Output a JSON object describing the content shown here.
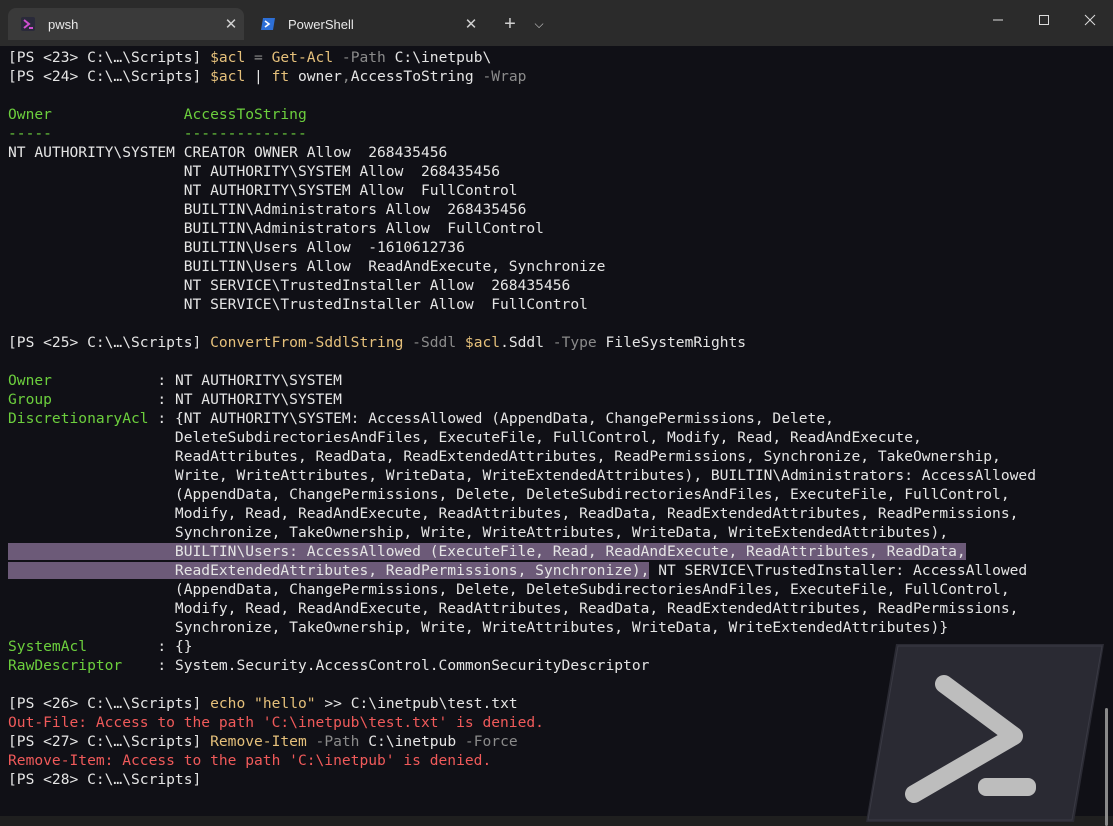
{
  "tabs": [
    {
      "label": "pwsh",
      "icon": "pwsh-icon",
      "active": true
    },
    {
      "label": "PowerShell",
      "icon": "powershell-icon",
      "active": false
    }
  ],
  "colors": {
    "background": "#101016",
    "prompt": "#e5e5e5",
    "keyword": "#e5c07b",
    "label": "#6ccf3d",
    "error": "#f05a5a",
    "selection": "#6a5a78"
  },
  "terminal": {
    "lines": [
      [
        {
          "t": "[PS <23> C:\\…\\Scripts] ",
          "c": "prompt"
        },
        {
          "t": "$acl",
          "c": "var"
        },
        {
          "t": " = ",
          "c": "param"
        },
        {
          "t": "Get-Acl",
          "c": "kw"
        },
        {
          "t": " -Path ",
          "c": "param"
        },
        {
          "t": "C:\\inetpub\\",
          "c": "prompt"
        }
      ],
      [
        {
          "t": "[PS <24> C:\\…\\Scripts] ",
          "c": "prompt"
        },
        {
          "t": "$acl",
          "c": "var"
        },
        {
          "t": " | ",
          "c": "prompt"
        },
        {
          "t": "ft",
          "c": "kw"
        },
        {
          "t": " owner",
          "c": "prompt"
        },
        {
          "t": ",",
          "c": "param"
        },
        {
          "t": "AccessToString",
          "c": "prompt"
        },
        {
          "t": " -Wrap",
          "c": "param"
        }
      ],
      [],
      [
        {
          "t": "Owner               ",
          "c": "lbl"
        },
        {
          "t": "AccessToString",
          "c": "lbl"
        }
      ],
      [
        {
          "t": "-----               ",
          "c": "lbl"
        },
        {
          "t": "--------------",
          "c": "lbl"
        }
      ],
      [
        {
          "t": "NT AUTHORITY\\SYSTEM CREATOR OWNER Allow  268435456",
          "c": "prompt"
        }
      ],
      [
        {
          "t": "                    NT AUTHORITY\\SYSTEM Allow  268435456",
          "c": "prompt"
        }
      ],
      [
        {
          "t": "                    NT AUTHORITY\\SYSTEM Allow  FullControl",
          "c": "prompt"
        }
      ],
      [
        {
          "t": "                    BUILTIN\\Administrators Allow  268435456",
          "c": "prompt"
        }
      ],
      [
        {
          "t": "                    BUILTIN\\Administrators Allow  FullControl",
          "c": "prompt"
        }
      ],
      [
        {
          "t": "                    BUILTIN\\Users Allow  -1610612736",
          "c": "prompt"
        }
      ],
      [
        {
          "t": "                    BUILTIN\\Users Allow  ReadAndExecute, Synchronize",
          "c": "prompt"
        }
      ],
      [
        {
          "t": "                    NT SERVICE\\TrustedInstaller Allow  268435456",
          "c": "prompt"
        }
      ],
      [
        {
          "t": "                    NT SERVICE\\TrustedInstaller Allow  FullControl",
          "c": "prompt"
        }
      ],
      [],
      [
        {
          "t": "[PS <25> C:\\…\\Scripts] ",
          "c": "prompt"
        },
        {
          "t": "ConvertFrom-SddlString",
          "c": "kw"
        },
        {
          "t": " -Sddl ",
          "c": "param"
        },
        {
          "t": "$acl",
          "c": "var"
        },
        {
          "t": ".Sddl",
          "c": "prompt"
        },
        {
          "t": " -Type ",
          "c": "param"
        },
        {
          "t": "FileSystemRights",
          "c": "prompt"
        }
      ],
      [],
      [
        {
          "t": "Owner            ",
          "c": "lbl"
        },
        {
          "t": ": NT AUTHORITY\\SYSTEM",
          "c": "prompt"
        }
      ],
      [
        {
          "t": "Group            ",
          "c": "lbl"
        },
        {
          "t": ": NT AUTHORITY\\SYSTEM",
          "c": "prompt"
        }
      ],
      [
        {
          "t": "DiscretionaryAcl ",
          "c": "lbl"
        },
        {
          "t": ": {NT AUTHORITY\\SYSTEM: AccessAllowed (AppendData, ChangePermissions, Delete,",
          "c": "prompt"
        }
      ],
      [
        {
          "t": "                   DeleteSubdirectoriesAndFiles, ExecuteFile, FullControl, Modify, Read, ReadAndExecute,",
          "c": "prompt"
        }
      ],
      [
        {
          "t": "                   ReadAttributes, ReadData, ReadExtendedAttributes, ReadPermissions, Synchronize, TakeOwnership,",
          "c": "prompt"
        }
      ],
      [
        {
          "t": "                   Write, WriteAttributes, WriteData, WriteExtendedAttributes), BUILTIN\\Administrators: AccessAllowed",
          "c": "prompt"
        }
      ],
      [
        {
          "t": "                   (AppendData, ChangePermissions, Delete, DeleteSubdirectoriesAndFiles, ExecuteFile, FullControl,",
          "c": "prompt"
        }
      ],
      [
        {
          "t": "                   Modify, Read, ReadAndExecute, ReadAttributes, ReadData, ReadExtendedAttributes, ReadPermissions,",
          "c": "prompt"
        }
      ],
      [
        {
          "t": "                   Synchronize, TakeOwnership, Write, WriteAttributes, WriteData, WriteExtendedAttributes),",
          "c": "prompt"
        }
      ],
      [
        {
          "t": "                   BUILTIN\\Users: AccessAllowed (ExecuteFile, Read, ReadAndExecute, ReadAttributes, ReadData,",
          "c": "prompt",
          "hl": true
        }
      ],
      [
        {
          "t": "                   ReadExtendedAttributes, ReadPermissions, Synchronize),",
          "c": "prompt",
          "hl": true
        },
        {
          "t": " NT SERVICE\\TrustedInstaller: AccessAllowed",
          "c": "prompt"
        }
      ],
      [
        {
          "t": "                   (AppendData, ChangePermissions, Delete, DeleteSubdirectoriesAndFiles, ExecuteFile, FullControl,",
          "c": "prompt"
        }
      ],
      [
        {
          "t": "                   Modify, Read, ReadAndExecute, ReadAttributes, ReadData, ReadExtendedAttributes, ReadPermissions,",
          "c": "prompt"
        }
      ],
      [
        {
          "t": "                   Synchronize, TakeOwnership, Write, WriteAttributes, WriteData, WriteExtendedAttributes)}",
          "c": "prompt"
        }
      ],
      [
        {
          "t": "SystemAcl        ",
          "c": "lbl"
        },
        {
          "t": ": {}",
          "c": "prompt"
        }
      ],
      [
        {
          "t": "RawDescriptor    ",
          "c": "lbl"
        },
        {
          "t": ": System.Security.AccessControl.CommonSecurityDescriptor",
          "c": "prompt"
        }
      ],
      [],
      [
        {
          "t": "[PS <26> C:\\…\\Scripts] ",
          "c": "prompt"
        },
        {
          "t": "echo",
          "c": "kw"
        },
        {
          "t": " ",
          "c": "prompt"
        },
        {
          "t": "\"hello\"",
          "c": "str"
        },
        {
          "t": " >> ",
          "c": "prompt"
        },
        {
          "t": "C:\\inetpub\\test.txt",
          "c": "prompt"
        }
      ],
      [
        {
          "t": "Out-File: Access to the path 'C:\\inetpub\\test.txt' is denied.",
          "c": "err"
        }
      ],
      [
        {
          "t": "[PS <27> C:\\…\\Scripts] ",
          "c": "prompt"
        },
        {
          "t": "Remove-Item",
          "c": "kw"
        },
        {
          "t": " -Path ",
          "c": "param"
        },
        {
          "t": "C:\\inetpub",
          "c": "prompt"
        },
        {
          "t": " -Force",
          "c": "param"
        }
      ],
      [
        {
          "t": "Remove-Item: Access to the path 'C:\\inetpub' is denied.",
          "c": "err"
        }
      ],
      [
        {
          "t": "[PS <28> C:\\…\\Scripts] ",
          "c": "prompt"
        }
      ]
    ]
  }
}
